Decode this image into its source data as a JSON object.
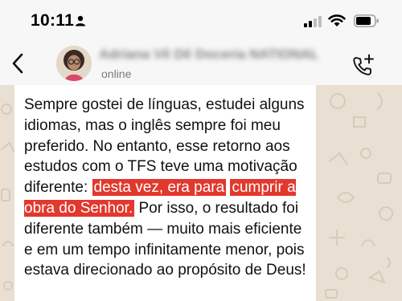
{
  "status_bar": {
    "time": "10:11"
  },
  "header": {
    "contact_name": "Adriana Vê Dê Doceria NATIONAL",
    "contact_status": "online",
    "icons": {
      "back": "chevron-left-icon",
      "call_add": "phone-plus-icon"
    }
  },
  "message": {
    "before": "Sempre gostei de línguas, estudei alguns idiomas, mas o inglês sempre foi meu preferido. No entanto, esse retorno aos estudos com o TFS teve uma motivação diferente:",
    "highlight_line1": "desta vez, era para",
    "highlight_line2": "cumprir a obra do Senhor.",
    "after": "Por isso, o resultado foi diferente também — muito mais eficiente e em um tempo infinitamente menor, pois estava direcionado ao propósito de Deus!"
  },
  "colors": {
    "highlight": "#e2382d",
    "chat_background": "#e9e0d3",
    "bubble": "#ffffff"
  }
}
